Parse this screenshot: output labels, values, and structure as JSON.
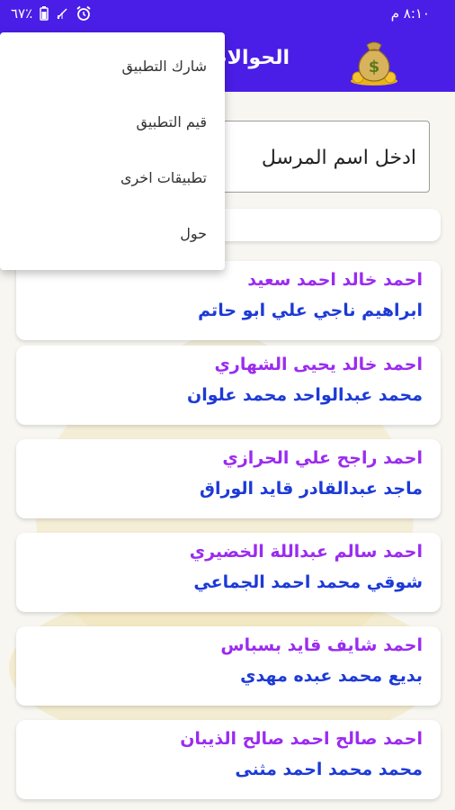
{
  "status_bar": {
    "battery": "٦٧٪",
    "time": "٨:١٠ م",
    "icons": [
      "battery-icon",
      "no-signal-icon",
      "alarm-icon"
    ]
  },
  "app_bar": {
    "title": "الحوالات",
    "logo": "money-bag-icon",
    "color": "#4a1ee6"
  },
  "search": {
    "placeholder": "ادخل اسم المرسل"
  },
  "overflow_menu": {
    "items": [
      {
        "label": "شارك التطبيق"
      },
      {
        "label": "قيم التطبيق"
      },
      {
        "label": "تطبيقات اخرى"
      },
      {
        "label": "حول"
      }
    ]
  },
  "transfers": [
    {
      "sender": "احمد خالد احمد سعيد",
      "receiver": "ابراهيم ناجي علي ابو حاتم"
    },
    {
      "sender": "احمد خالد يحيى الشهاري",
      "receiver": "محمد عبدالواحد محمد علوان"
    },
    {
      "sender": "احمد راجح علي الحرازي",
      "receiver": "ماجد عبدالقادر قايد الوراق"
    },
    {
      "sender": "احمد سالم عبداللة الخضيري",
      "receiver": "شوقي محمد احمد الجماعي"
    },
    {
      "sender": "احمد شايف قايد بسباس",
      "receiver": "بديع محمد عبده مهدي"
    },
    {
      "sender": "احمد صالح احمد صالح الذيبان",
      "receiver": "محمد محمد احمد مثنى"
    }
  ],
  "colors": {
    "sender_text": "#9b2bf0",
    "receiver_text": "#1d3ad6"
  }
}
